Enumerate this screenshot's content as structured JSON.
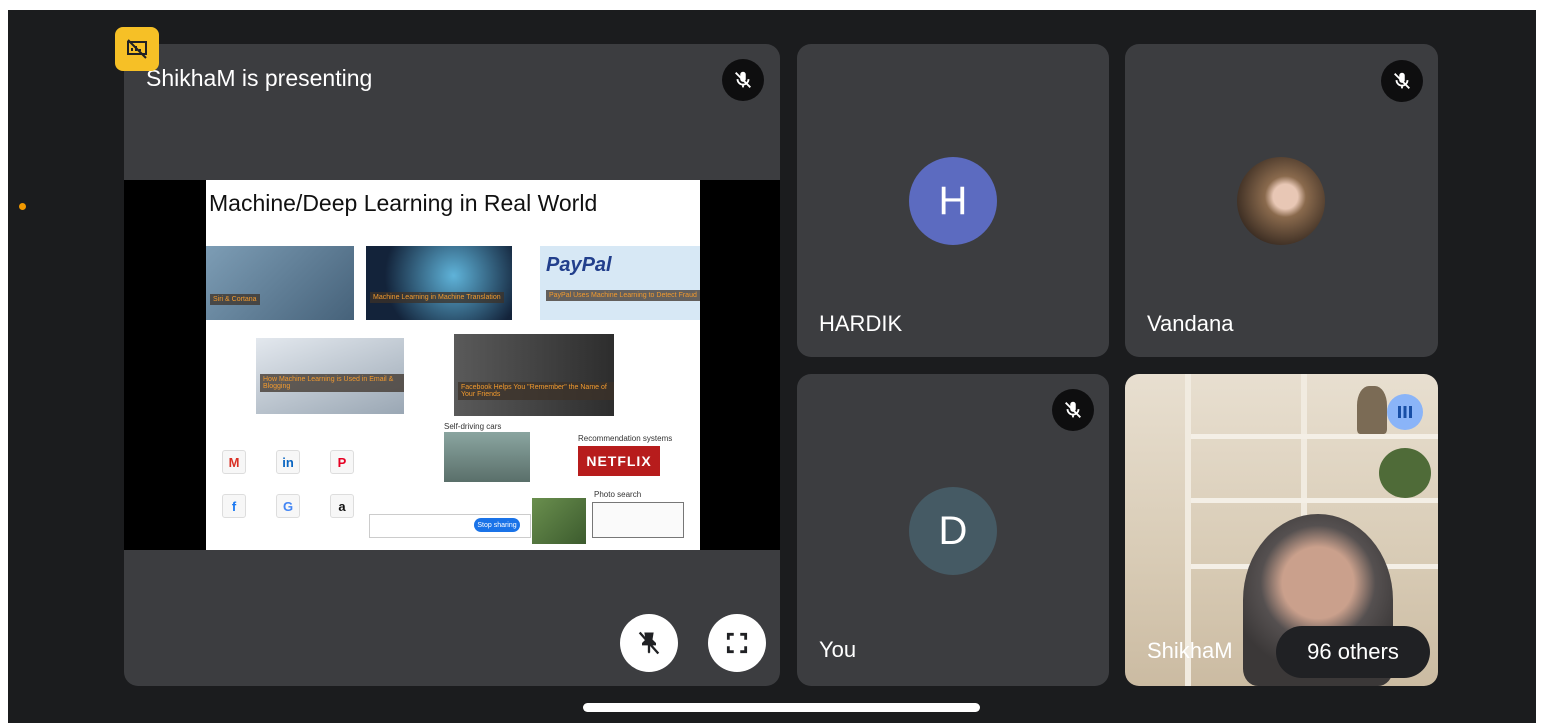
{
  "presenter": {
    "title": "ShikhaM is presenting",
    "badge_icon": "presentation-off-icon",
    "slide": {
      "title": "Machine/Deep Learning in Real World",
      "captions": [
        "Siri & Cortana",
        "Machine Learning in Machine Translation",
        "PayPal Uses Machine Learning to Detect Fraud",
        "How Machine Learning is Used in Email & Blogging",
        "Facebook Helps You \"Remember\" the Name of Your Friends"
      ],
      "paypal_label": "PayPal",
      "self_driving_label": "Self-driving cars",
      "recommendation_label": "Recommendation systems",
      "netflix_label": "NETFLIX",
      "photo_search_label": "Photo search",
      "stop_sharing_label": "Stop sharing"
    },
    "controls": [
      "unpin-icon",
      "fullscreen-icon"
    ]
  },
  "participants": [
    {
      "name": "HARDIK",
      "initial": "H",
      "avatar_color": "#5c6bc0",
      "muted": false
    },
    {
      "name": "Vandana",
      "initial": "",
      "muted": true
    },
    {
      "name": "You",
      "initial": "D",
      "avatar_color": "#455a64",
      "muted": true
    },
    {
      "name": "ShikhaM",
      "speaking": true
    }
  ],
  "others_label": "96 others",
  "colors": {
    "background": "#1b1c1e",
    "tile": "#3c3d40",
    "accent": "#f6c026",
    "speaking": "#8ab4f8"
  }
}
